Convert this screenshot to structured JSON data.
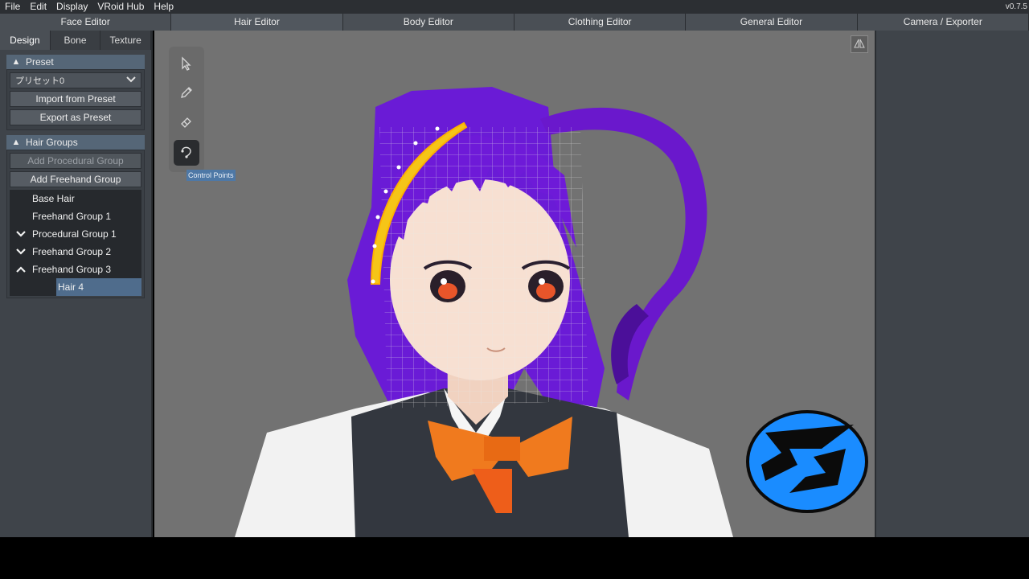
{
  "menu": [
    "File",
    "Edit",
    "Display",
    "VRoid Hub",
    "Help"
  ],
  "version": "v0.7.5",
  "editor_tabs": [
    "Face Editor",
    "Hair Editor",
    "Body Editor",
    "Clothing Editor",
    "General Editor",
    "Camera / Exporter"
  ],
  "active_editor": "Hair Editor",
  "sub_tabs": [
    "Design",
    "Bone",
    "Texture"
  ],
  "preset": {
    "title": "Preset",
    "selected": "プリセット0",
    "import_label": "Import from Preset",
    "export_label": "Export as Preset"
  },
  "hair_groups": {
    "title": "Hair Groups",
    "add_procedural": "Add Procedural Group",
    "add_freehand": "Add Freehand Group",
    "items": [
      {
        "label": "Base Hair",
        "icon": ""
      },
      {
        "label": "Freehand Group 1",
        "icon": ""
      },
      {
        "label": "Procedural Group 1",
        "icon": "chevron-down"
      },
      {
        "label": "Freehand Group 2",
        "icon": "chevron-down"
      },
      {
        "label": "Freehand Group 3",
        "icon": "chevron-up"
      }
    ],
    "selected_child": "Hair 4"
  },
  "tooltip": "Control Points",
  "colors": {
    "hair": "#7a1fe0",
    "bow": "#f07a1e",
    "logo": "#1a8cff",
    "accent": "#4e78a6"
  }
}
